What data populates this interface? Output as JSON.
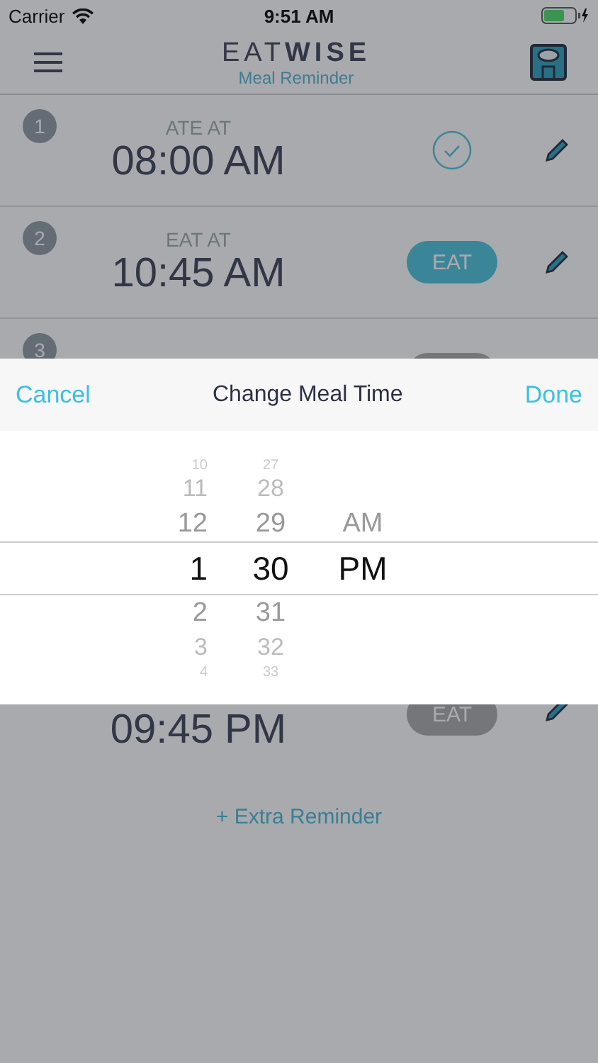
{
  "status_bar": {
    "carrier": "Carrier",
    "time": "9:51 AM"
  },
  "header": {
    "title": "EAT**WISE**",
    "subtitle": "Meal Reminder"
  },
  "rows": [
    {
      "number": "1",
      "label": "ATE AT",
      "time": "08:00 AM",
      "status": {
        "kind": "done"
      }
    },
    {
      "number": "2",
      "label": "EAT AT",
      "time": "10:45 AM",
      "status": {
        "kind": "eat",
        "label": "EAT",
        "disabled": false
      }
    },
    {
      "number": "3",
      "status": {
        "kind": "eat",
        "disabled": true
      }
    }
  ],
  "bottom_row": {
    "time": "09:45 PM",
    "status": {
      "kind": "eat",
      "label": "EAT",
      "disabled": true
    }
  },
  "extra_link": "+ Extra Reminder",
  "sheet": {
    "cancel": "Cancel",
    "title": "Change Meal Time",
    "done": "Done",
    "wheels": [
      {
        "items": [
          {
            "text": "10",
            "selected": false
          },
          {
            "text": "11",
            "selected": false
          },
          {
            "text": "12",
            "selected": false
          },
          {
            "text": "1",
            "selected": true
          },
          {
            "text": "2",
            "selected": false
          },
          {
            "text": "3",
            "selected": false
          },
          {
            "text": "4",
            "selected": false
          }
        ]
      },
      {
        "items": [
          {
            "text": "27",
            "selected": false
          },
          {
            "text": "28",
            "selected": false
          },
          {
            "text": "29",
            "selected": false
          },
          {
            "text": "30",
            "selected": true
          },
          {
            "text": "31",
            "selected": false
          },
          {
            "text": "32",
            "selected": false
          },
          {
            "text": "33",
            "selected": false
          }
        ]
      },
      {
        "items": [
          {
            "text": "AM",
            "selected": false
          },
          {
            "text": "PM",
            "selected": true
          }
        ]
      }
    ]
  }
}
